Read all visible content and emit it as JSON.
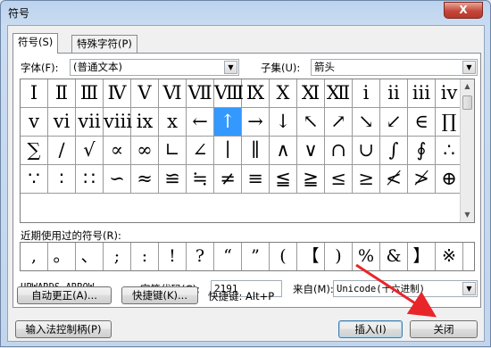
{
  "window": {
    "title": "符号",
    "close_glyph": "X"
  },
  "tabs": [
    {
      "label": "符号(S)"
    },
    {
      "label": "特殊字符(P)"
    }
  ],
  "font": {
    "label": "字体(F):",
    "value": "(普通文本)"
  },
  "subset": {
    "label": "子集(U):",
    "value": "箭头"
  },
  "symbols": [
    "Ⅰ",
    "Ⅱ",
    "Ⅲ",
    "Ⅳ",
    "Ⅴ",
    "Ⅵ",
    "Ⅶ",
    "Ⅷ",
    "Ⅸ",
    "Ⅹ",
    "Ⅺ",
    "Ⅻ",
    "ⅰ",
    "ⅱ",
    "ⅲ",
    "ⅳ",
    "ⅴ",
    "ⅵ",
    "ⅶ",
    "ⅷ",
    "ⅸ",
    "ⅹ",
    "←",
    "↑",
    "→",
    "↓",
    "↖",
    "↗",
    "↘",
    "↙",
    "∈",
    "∏",
    "∑",
    "∕",
    "√",
    "∝",
    "∞",
    "∟",
    "∠",
    "∣",
    "∥",
    "∧",
    "∨",
    "∩",
    "∪",
    "∫",
    "∮",
    "∴",
    "∵",
    "∶",
    "∷",
    "∽",
    "≈",
    "≌",
    "≒",
    "≠",
    "≡",
    "≦",
    "≧",
    "≤",
    "≥",
    "≮",
    "≯",
    "⊕"
  ],
  "selected_symbol": "↑",
  "recent": {
    "label": "近期使用过的符号(R):",
    "items": [
      ",",
      "。",
      "、",
      ";",
      ":",
      "!",
      "?",
      "“",
      "”",
      "(",
      "【",
      ")",
      "%",
      "&",
      "】",
      "※"
    ]
  },
  "char_name": "UPWARDS ARROW",
  "char_code": {
    "label": "字符代码(C):",
    "value": "2191"
  },
  "from": {
    "label": "来自(M):",
    "value": "Unicode(十六进制)"
  },
  "buttons": {
    "autocorrect": "自动更正(A)...",
    "shortcut_key": "快捷键(K)...",
    "shortcut_text": "快捷键: Alt+P",
    "ime": "输入法控制柄(P)",
    "insert": "插入(I)",
    "close": "关闭"
  },
  "colors": {
    "selection": "#3399ff",
    "annotation_arrow": "#e8262a"
  }
}
